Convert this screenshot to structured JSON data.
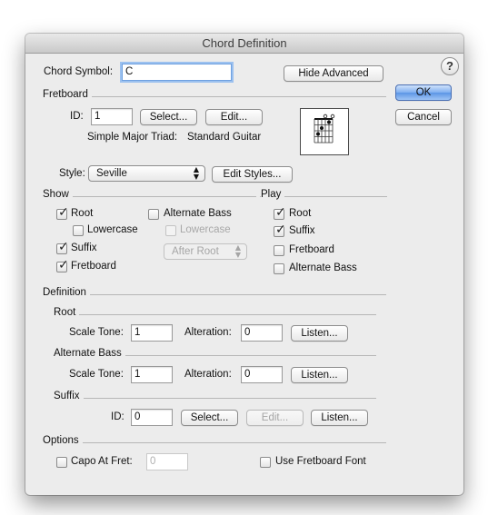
{
  "window": {
    "title": "Chord Definition"
  },
  "header": {
    "chord_symbol_label": "Chord Symbol:",
    "chord_symbol_value": "C",
    "hide_advanced_label": "Hide Advanced",
    "help_label": "?"
  },
  "actions": {
    "ok_label": "OK",
    "cancel_label": "Cancel"
  },
  "fretboard": {
    "section_label": "Fretboard",
    "id_label": "ID:",
    "id_value": "1",
    "select_label": "Select...",
    "edit_label": "Edit...",
    "chord_name": "Simple Major Triad:",
    "instrument": "Standard Guitar"
  },
  "style": {
    "label": "Style:",
    "value": "Seville",
    "edit_styles_label": "Edit Styles..."
  },
  "show": {
    "section_label": "Show",
    "root": {
      "label": "Root",
      "checked": true
    },
    "lowercase": {
      "label": "Lowercase",
      "checked": false
    },
    "suffix": {
      "label": "Suffix",
      "checked": true
    },
    "fretboard": {
      "label": "Fretboard",
      "checked": true
    },
    "alternate_bass": {
      "label": "Alternate Bass",
      "checked": false
    },
    "alt_lowercase": {
      "label": "Lowercase",
      "checked": false,
      "disabled": true
    },
    "alt_position": {
      "value": "After Root",
      "disabled": true
    }
  },
  "play": {
    "section_label": "Play",
    "root": {
      "label": "Root",
      "checked": true
    },
    "suffix": {
      "label": "Suffix",
      "checked": true
    },
    "fretboard": {
      "label": "Fretboard",
      "checked": false
    },
    "alternate_bass": {
      "label": "Alternate Bass",
      "checked": false
    }
  },
  "definition": {
    "section_label": "Definition",
    "root": {
      "section_label": "Root",
      "scale_tone_label": "Scale Tone:",
      "scale_tone_value": "1",
      "alteration_label": "Alteration:",
      "alteration_value": "0",
      "listen_label": "Listen..."
    },
    "alternate_bass": {
      "section_label": "Alternate Bass",
      "scale_tone_label": "Scale Tone:",
      "scale_tone_value": "1",
      "alteration_label": "Alteration:",
      "alteration_value": "0",
      "listen_label": "Listen..."
    },
    "suffix": {
      "section_label": "Suffix",
      "id_label": "ID:",
      "id_value": "0",
      "select_label": "Select...",
      "edit_label": "Edit...",
      "listen_label": "Listen..."
    }
  },
  "options": {
    "section_label": "Options",
    "capo": {
      "label": "Capo At Fret:",
      "checked": false,
      "value": "0"
    },
    "use_fretboard_font": {
      "label": "Use Fretboard Font",
      "checked": false
    }
  },
  "colors": {
    "default_button": "#5b95e6",
    "window_bg": "#ececec"
  }
}
